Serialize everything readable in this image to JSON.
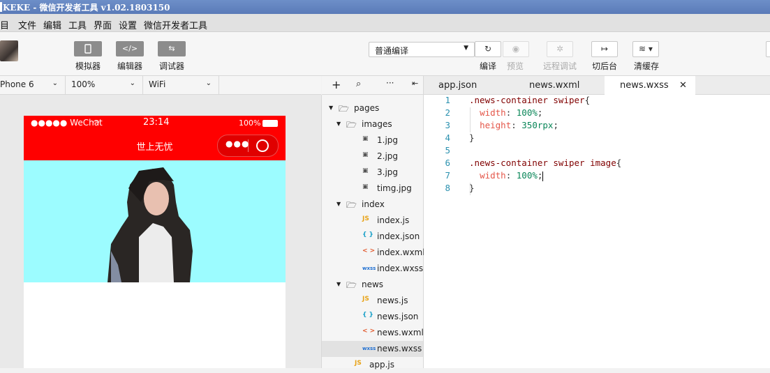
{
  "window": {
    "title": "KEKE - 微信开发者工具 v1.02.1803150"
  },
  "menu": [
    "目",
    "文件",
    "编辑",
    "工具",
    "界面",
    "设置",
    "微信开发者工具"
  ],
  "toolbar": {
    "simulator": "模拟器",
    "editor": "编辑器",
    "debugger": "调试器",
    "compile_mode": "普通编译",
    "compile": "编译",
    "preview": "预览",
    "remote_debug": "远程调试",
    "background": "切后台",
    "clear_cache": "清缓存"
  },
  "devicebar": {
    "device": "Phone 6",
    "zoom": "100%",
    "network": "WiFi"
  },
  "phone": {
    "signal": "●●●●● WeChat",
    "time": "23:14",
    "battery": "100%",
    "nav_title": "世上无忧"
  },
  "tree": [
    {
      "label": "pages",
      "type": "folder",
      "depth": 0,
      "open": true
    },
    {
      "label": "images",
      "type": "folder",
      "depth": 1,
      "open": true
    },
    {
      "label": "1.jpg",
      "type": "image",
      "depth": 2
    },
    {
      "label": "2.jpg",
      "type": "image",
      "depth": 2
    },
    {
      "label": "3.jpg",
      "type": "image",
      "depth": 2
    },
    {
      "label": "timg.jpg",
      "type": "image",
      "depth": 2
    },
    {
      "label": "index",
      "type": "folder",
      "depth": 1,
      "open": true
    },
    {
      "label": "index.js",
      "type": "js",
      "depth": 2
    },
    {
      "label": "index.json",
      "type": "json",
      "depth": 2
    },
    {
      "label": "index.wxml",
      "type": "wxml",
      "depth": 2
    },
    {
      "label": "index.wxss",
      "type": "wxss",
      "depth": 2
    },
    {
      "label": "news",
      "type": "folder",
      "depth": 1,
      "open": true
    },
    {
      "label": "news.js",
      "type": "js",
      "depth": 2
    },
    {
      "label": "news.json",
      "type": "json",
      "depth": 2
    },
    {
      "label": "news.wxml",
      "type": "wxml",
      "depth": 2
    },
    {
      "label": "news.wxss",
      "type": "wxss",
      "depth": 2,
      "selected": true
    },
    {
      "label": "app.js",
      "type": "js",
      "depth": 1
    }
  ],
  "tabs": [
    "app.json",
    "news.wxml",
    "news.wxss"
  ],
  "active_tab": "news.wxss",
  "code": [
    {
      "n": "1",
      "t": ".news-container swiper{"
    },
    {
      "n": "2",
      "t": "  width: 100%;"
    },
    {
      "n": "3",
      "t": "  height: 350rpx;"
    },
    {
      "n": "4",
      "t": "}"
    },
    {
      "n": "5",
      "t": ""
    },
    {
      "n": "6",
      "t": ".news-container swiper image{"
    },
    {
      "n": "7",
      "t": "  width: 100%;"
    },
    {
      "n": "8",
      "t": "}"
    }
  ],
  "colors": {
    "nav_red": "#ff0000",
    "swiper_bg": "#9cfcff",
    "title_bar": "#5a7bb8"
  }
}
